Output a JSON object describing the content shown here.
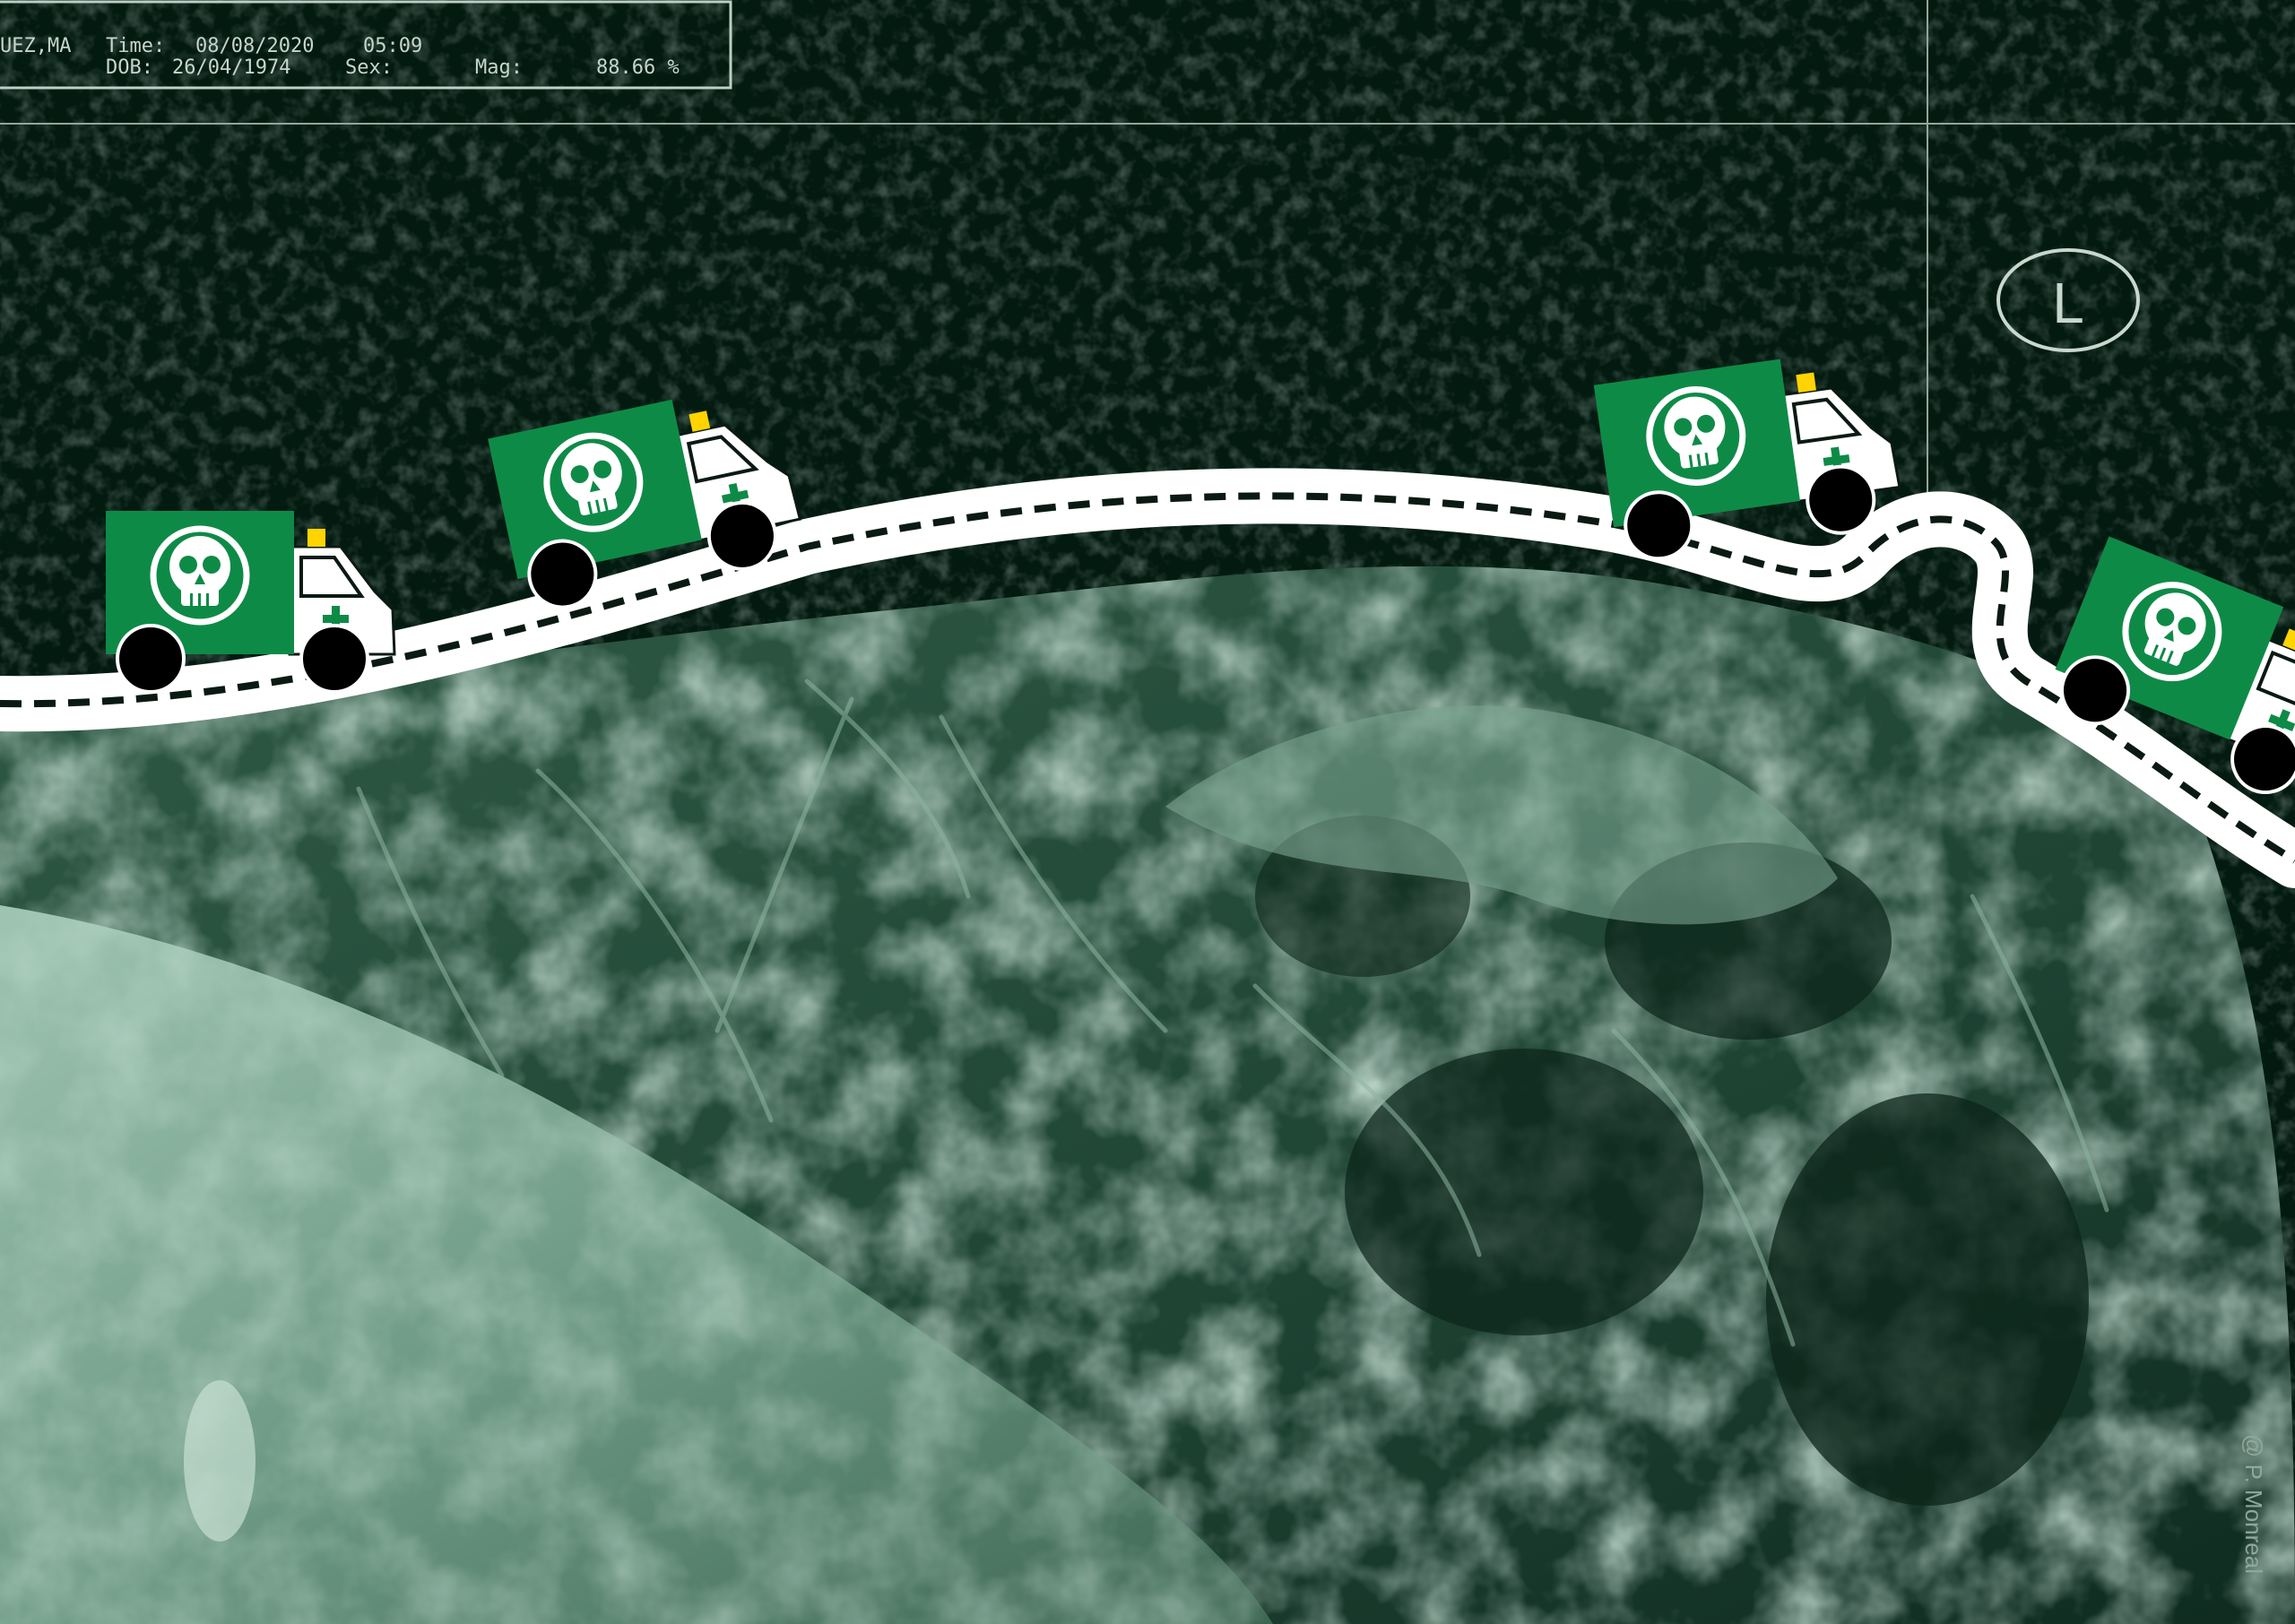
{
  "header": {
    "patient": "UEZ,MA",
    "time_label": "Time:",
    "time_value": "08/08/2020",
    "clock": "05:09",
    "dob_label": "DOB:",
    "dob_value": "26/04/1974",
    "sex_label": "Sex:",
    "mag_label": "Mag:",
    "mag_value": "88.66 %"
  },
  "marker": "L",
  "credit": "@ P. Monreal",
  "colors": {
    "background": "#031a10",
    "tissue": "#6f9a86",
    "ambulance_green": "#0e8a47",
    "road": "#ffffff",
    "lane": "#0a1a12",
    "beacon": "#ffd400"
  },
  "icons": {
    "ambulance": "ambulance-icon",
    "skull": "skull-icon",
    "cross": "medical-cross-icon"
  }
}
